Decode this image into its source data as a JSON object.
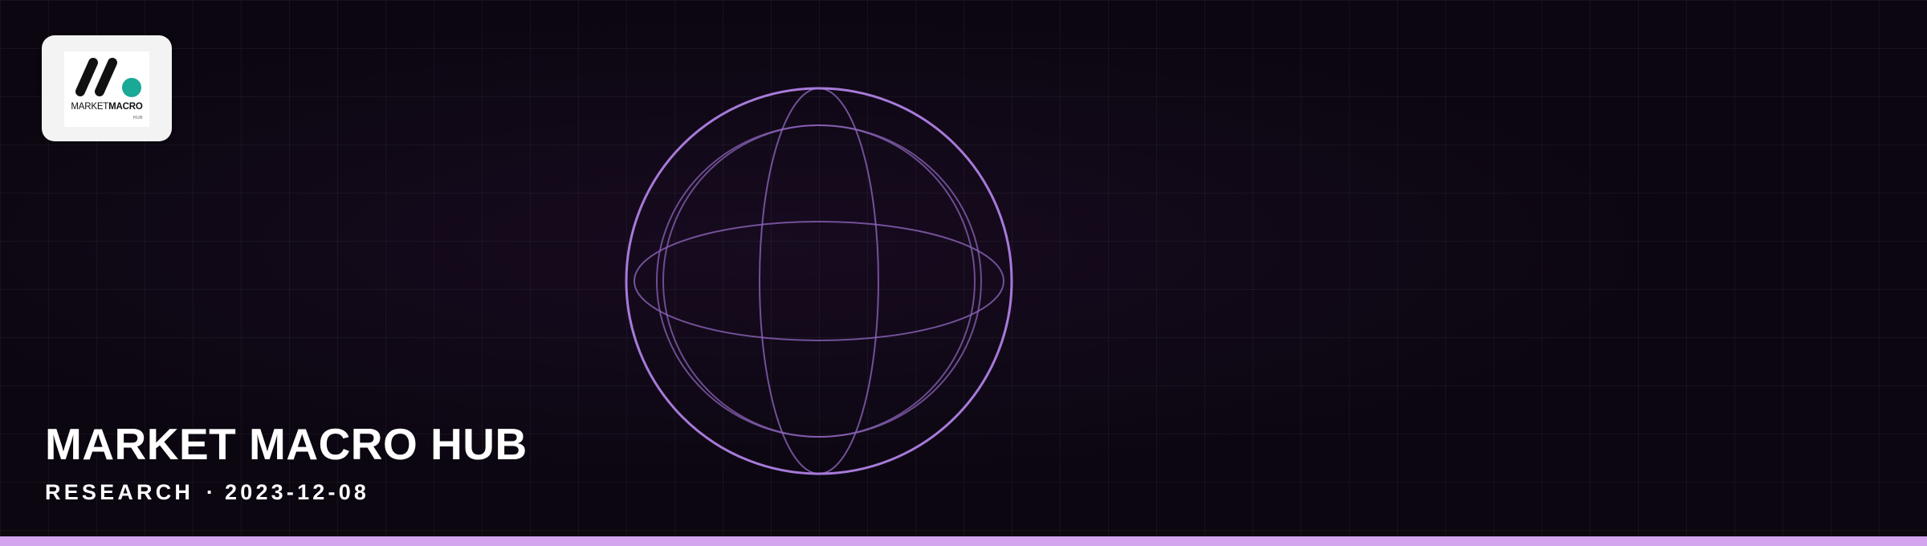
{
  "banner": {
    "logo": {
      "wordmark_light": "MARKET",
      "wordmark_bold": "MACRO",
      "sub": "HUB",
      "icon": "market-macro-hub-logo-icon",
      "colors": {
        "mark": "#111111",
        "dot": "#1aa897"
      }
    },
    "globe": {
      "icon": "wireframe-globe-icon",
      "color": "#9b6fd0"
    },
    "title": "MARKET MACRO HUB",
    "category": "RESEARCH",
    "separator": "·",
    "date": "2023-12-08",
    "colors": {
      "background": "#0b0610",
      "accent_bar": "#d3a5ef",
      "text": "#ffffff"
    }
  }
}
